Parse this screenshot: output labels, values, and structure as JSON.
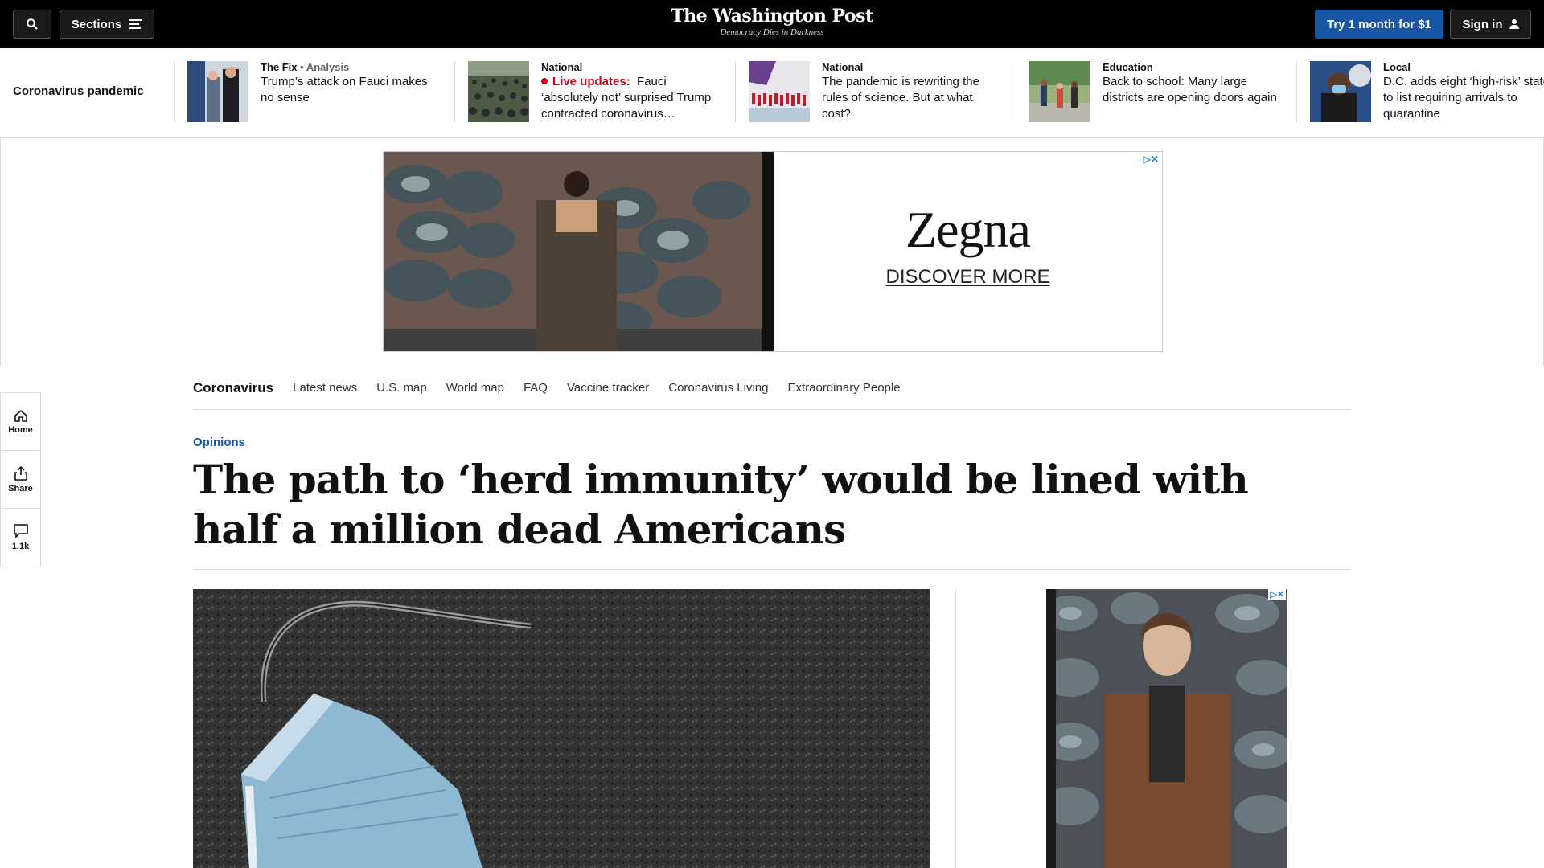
{
  "topbar": {
    "search_icon": "search-icon",
    "sections_label": "Sections",
    "logo": "The Washington Post",
    "tagline": "Democracy Dies in Darkness",
    "try_label": "Try 1 month for $1",
    "sign_in_label": "Sign in"
  },
  "strip": {
    "title": "Coronavirus pandemic",
    "items": [
      {
        "kicker": "The Fix",
        "kicker_extra": "• Analysis",
        "headline": "Trump’s attack on Fauci makes no sense"
      },
      {
        "kicker": "National",
        "live_label": "Live updates:",
        "headline": "Fauci ‘absolutely not’ surprised Trump contracted coronavirus…"
      },
      {
        "kicker": "National",
        "headline": "The pandemic is rewriting the rules of science. But at what cost?"
      },
      {
        "kicker": "Education",
        "headline": "Back to school: Many large districts are opening doors again"
      },
      {
        "kicker": "Local",
        "headline": "D.C. adds eight ‘high-risk’ states to list requiring arrivals to quarantine"
      }
    ]
  },
  "ad": {
    "brand": "Zegna",
    "cta": "DISCOVER MORE",
    "choices": "▷✕"
  },
  "secnav": {
    "brand": "Coronavirus",
    "links": [
      "Latest news",
      "U.S. map",
      "World map",
      "FAQ",
      "Vaccine tracker",
      "Coronavirus Living",
      "Extraordinary People"
    ]
  },
  "rail": {
    "home": "Home",
    "share": "Share",
    "comments": "1.1k"
  },
  "article": {
    "kicker": "Opinions",
    "headline": "The path to ‘herd immunity’ would be lined with half a million dead Americans"
  },
  "side_ad": {
    "choices": "▷✕"
  },
  "colors": {
    "accent": "#1955a5",
    "live": "#d0021b",
    "topbar": "#000000"
  }
}
